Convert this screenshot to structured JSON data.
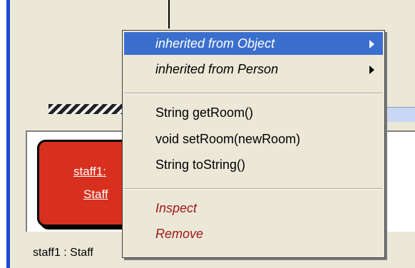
{
  "object_bench": {
    "object_name": "staff1:",
    "object_class": "Staff",
    "status_text": "staff1 : Staff"
  },
  "context_menu": {
    "inherited": [
      {
        "label": "inherited from Object",
        "selected": true
      },
      {
        "label": "inherited from Person",
        "selected": false
      }
    ],
    "methods": [
      {
        "label": "String getRoom()"
      },
      {
        "label": "void setRoom(newRoom)"
      },
      {
        "label": "String toString()"
      }
    ],
    "actions": [
      {
        "label": "Inspect"
      },
      {
        "label": "Remove"
      }
    ]
  },
  "colors": {
    "object_card": "#d8301e",
    "menu_highlight": "#3b6fce",
    "danger_text": "#a01818",
    "window_bar": "#1b49d6"
  },
  "icons": {
    "submenu_arrow": "triangle-right"
  }
}
